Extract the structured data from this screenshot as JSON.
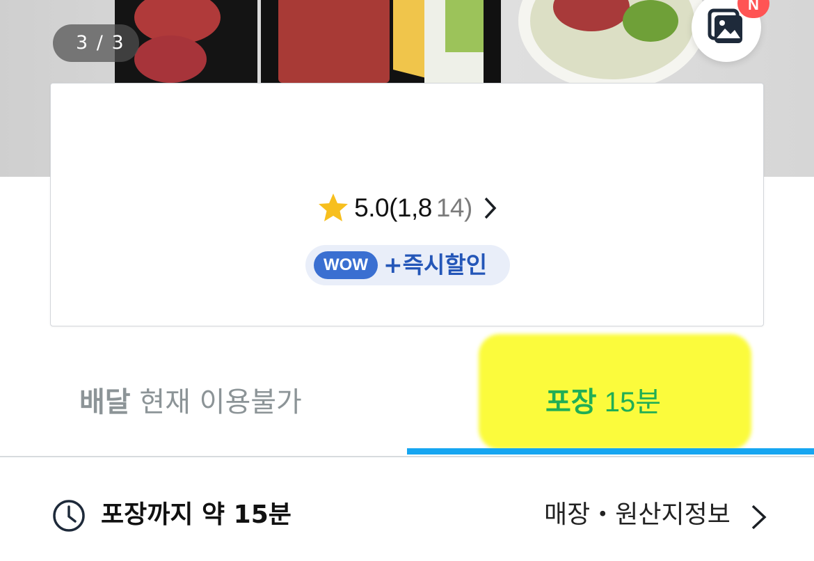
{
  "hero": {
    "counter": "3 / 3",
    "new_badge": "N"
  },
  "store": {
    "name": "",
    "rating": "5.0(1,8",
    "review_count_partial": "14)",
    "promo_badge": "WOW",
    "promo_text": "+즉시할인"
  },
  "tabs": {
    "delivery_label": "배달",
    "delivery_status": " 현재 이용불가",
    "pickup_label": "포장",
    "pickup_time": " 15분"
  },
  "info": {
    "eta": "포장까지 약 15분",
    "store_link": "매장・원산지정보"
  },
  "colors": {
    "accent_blue": "#16a6f1",
    "pickup_green": "#20ae55",
    "highlight_yellow": "#fbfb3c",
    "badge_red": "#ff5454",
    "wow_blue": "#3a6fd1"
  }
}
